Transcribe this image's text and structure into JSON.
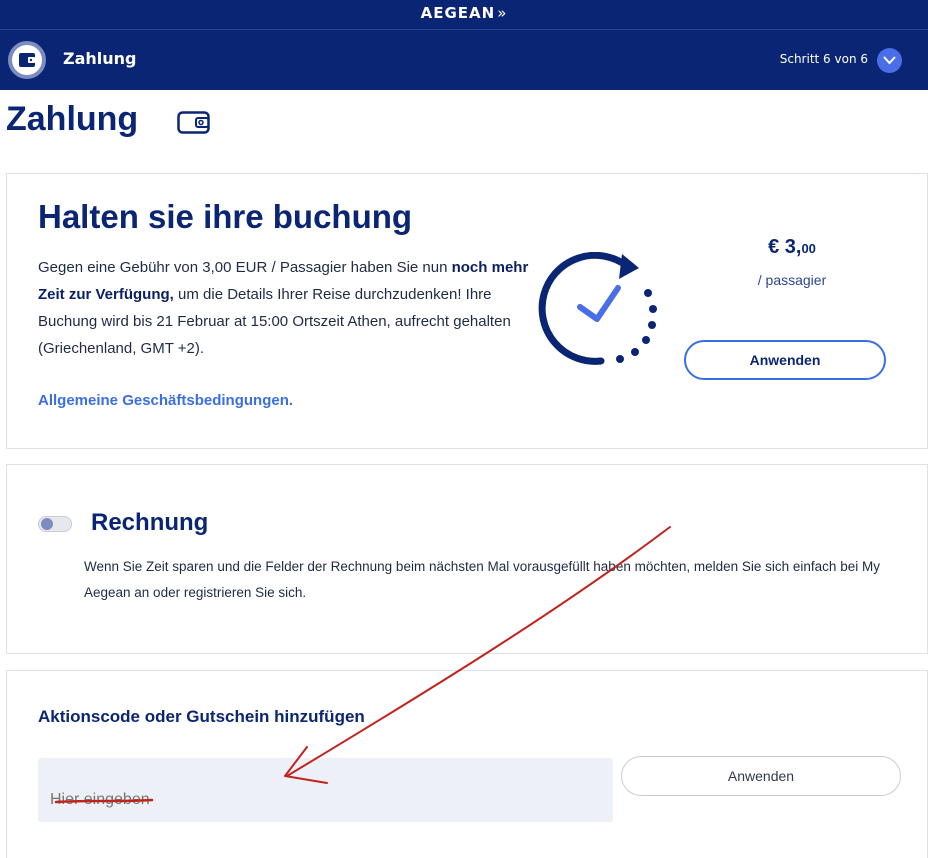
{
  "header": {
    "logo_text": "AEGEAN",
    "step_title": "Zahlung",
    "step_count": "Schritt 6 von 6",
    "icons": [
      "wallet-icon",
      "chevron-down-icon"
    ]
  },
  "page": {
    "title": "Zahlung"
  },
  "hold": {
    "title": "Halten sie ihre buchung",
    "text_before": "Gegen eine Gebühr von 3,00 EUR / Passagier haben Sie nun ",
    "text_bold": "noch mehr Zeit zur Verfügung,",
    "text_after": " um die Details Ihrer Reise durchzudenken! Ihre Buchung wird bis 21 Februar at 15:00 Ortszeit Athen, aufrecht gehalten (Griechenland, GMT +2).",
    "terms_link": "Allgemeine Geschäftsbedingungen.",
    "price_main": "€ 3,",
    "price_cents": "00",
    "per_passenger": "/ passagier",
    "apply_label": "Anwenden"
  },
  "invoice": {
    "title": "Rechnung",
    "toggle_on": false,
    "text": "Wenn Sie Zeit sparen und die Felder der Rechnung beim nächsten Mal vorausgefüllt haben möchten, melden Sie sich einfach bei My Aegean an oder registrieren Sie sich."
  },
  "promo": {
    "title": "Aktionscode oder Gutschein hinzufügen",
    "placeholder": "Hier eingeben",
    "value": "",
    "apply_label": "Anwenden"
  },
  "colors": {
    "brand_navy": "#0b2575",
    "accent_blue": "#3b6fe0",
    "annotation_red": "#c0221e"
  }
}
